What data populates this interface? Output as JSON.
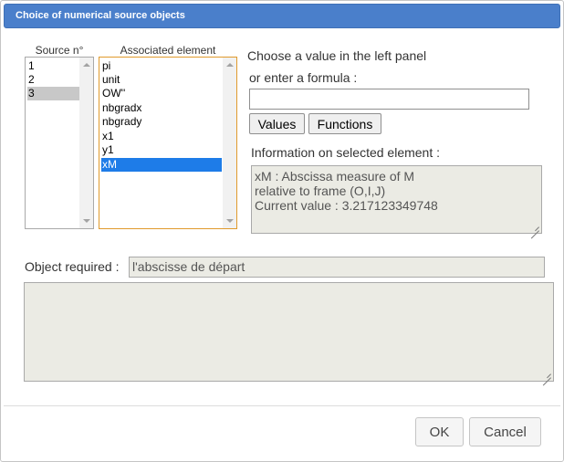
{
  "dialog": {
    "title": "Choice of numerical source objects"
  },
  "source": {
    "header": "Source n°",
    "items": [
      "1",
      "2",
      "3"
    ],
    "selected": "3"
  },
  "associated": {
    "header": "Associated element",
    "items": [
      "pi",
      "unit",
      "OW''",
      "nbgradx",
      "nbgrady",
      "x1",
      "y1",
      "xM"
    ],
    "selected": "xM"
  },
  "formula": {
    "prompt_line1": "Choose a value in the left panel",
    "prompt_line2": "or enter a formula :",
    "value": "",
    "values_button": "Values",
    "functions_button": "Functions"
  },
  "info": {
    "label": "Information on selected element :",
    "lines": [
      "xM : Abscissa measure of M",
      "relative to frame (O,I,J)",
      "Current value : 3.217123349748"
    ]
  },
  "object_required": {
    "label": "Object required :",
    "value": "l'abscisse de départ",
    "description": ""
  },
  "footer": {
    "ok_label": "OK",
    "cancel_label": "Cancel"
  },
  "colors": {
    "titlebar": "#4a7fcb",
    "selection_blue": "#1e7ce8",
    "selection_gray": "#c8c8c8",
    "assoc_border": "#e09a2c",
    "readonly_bg": "#ebebe4"
  }
}
